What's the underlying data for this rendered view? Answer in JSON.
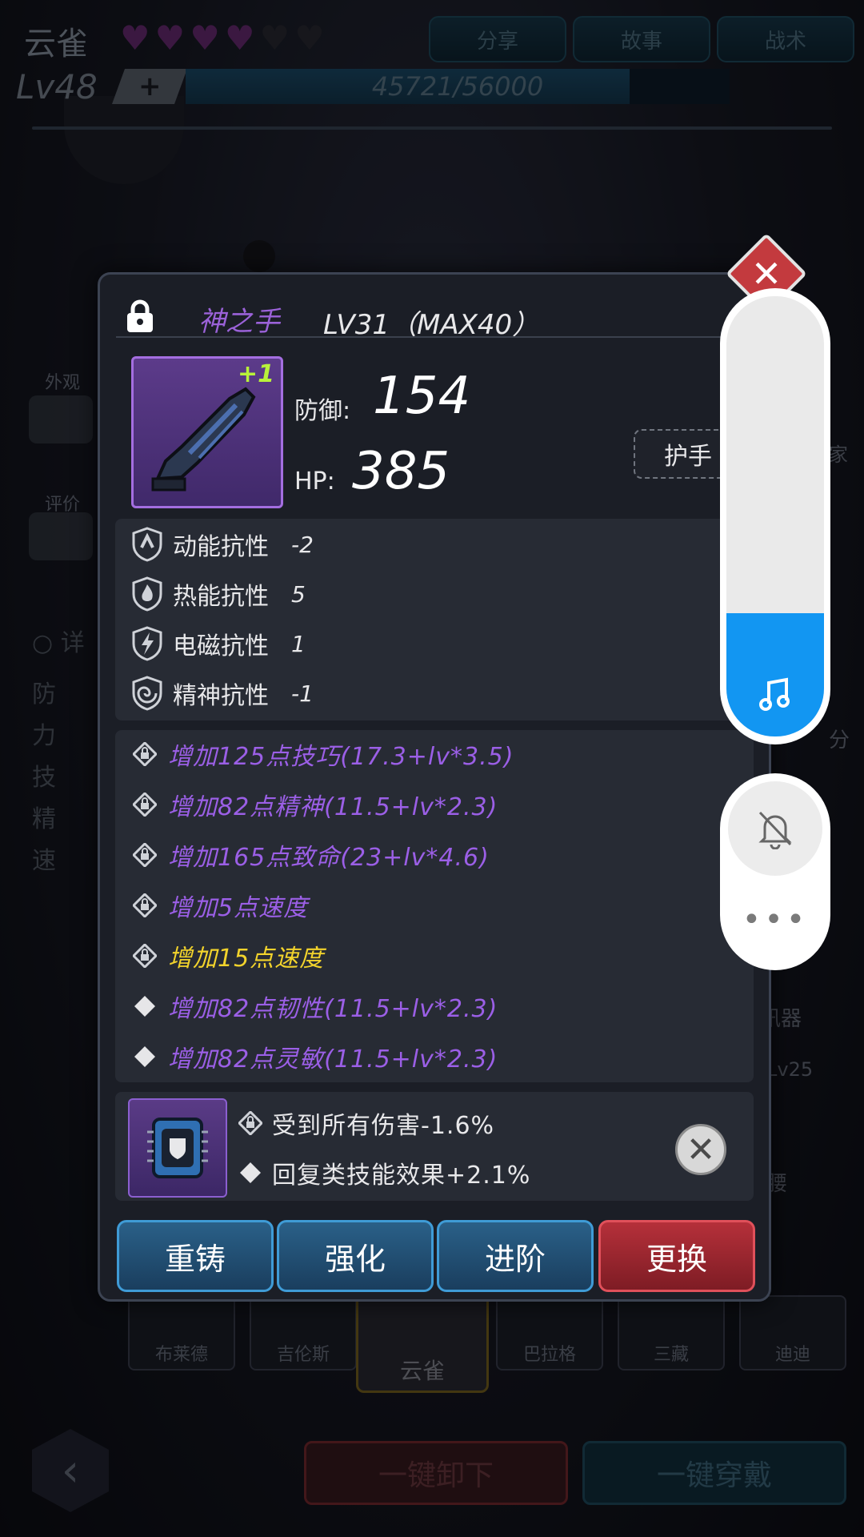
{
  "header": {
    "hero_name": "云雀",
    "hearts_filled": 4,
    "hearts_total": 6,
    "tabs": [
      "分享",
      "故事",
      "战术"
    ],
    "level": "Lv48",
    "plus": "+",
    "xp": "45721/56000",
    "xp_fraction": 0.816
  },
  "side": {
    "appearance_label": "外观",
    "rating_label": "评价",
    "detail_label": "详",
    "detail_rows": [
      "防",
      "力",
      "技",
      "精",
      "速"
    ]
  },
  "item": {
    "name": "神之手",
    "level_text": "LV31（MAX40）",
    "plus_badge": "+1",
    "defense_label": "防御:",
    "defense_value": "154",
    "hp_label": "HP:",
    "hp_value": "385",
    "slot": "护手"
  },
  "resistances": [
    {
      "name": "动能抗性",
      "value": "-2",
      "icon": "kinetic-resist-icon"
    },
    {
      "name": "热能抗性",
      "value": "5",
      "icon": "thermal-resist-icon"
    },
    {
      "name": "电磁抗性",
      "value": "1",
      "icon": "electromagnetic-resist-icon"
    },
    {
      "name": "精神抗性",
      "value": "-1",
      "icon": "mental-resist-icon"
    }
  ],
  "attributes": [
    {
      "text": "增加125点技巧(17.3+lv*3.5)",
      "color": "purple",
      "icon": "locked-attr-icon"
    },
    {
      "text": "增加82点精神(11.5+lv*2.3)",
      "color": "purple",
      "icon": "locked-attr-icon"
    },
    {
      "text": "增加165点致命(23+lv*4.6)",
      "color": "purple",
      "icon": "locked-attr-icon"
    },
    {
      "text": "增加5点速度",
      "color": "purple",
      "icon": "locked-attr-icon"
    },
    {
      "text": "增加15点速度",
      "color": "yellow",
      "icon": "locked-attr-icon"
    },
    {
      "text": "增加82点韧性(11.5+lv*2.3)",
      "color": "purple",
      "icon": "diamond-icon"
    },
    {
      "text": "增加82点灵敏(11.5+lv*2.3)",
      "color": "purple",
      "icon": "diamond-icon"
    }
  ],
  "gem": {
    "effects": [
      "受到所有伤害-1.6%",
      "回复类技能效果+2.1%"
    ]
  },
  "actions": [
    "重铸",
    "强化",
    "进阶",
    "更换"
  ],
  "bottom": {
    "heroes": [
      "布莱德",
      "吉伦斯",
      "云雀",
      "巴拉格",
      "三藏",
      "迪迪"
    ],
    "unequip_all": "一键卸下",
    "equip_all": "一键穿戴"
  },
  "right_peek": {
    "labels": [
      "家",
      "分",
      "讯器",
      "Lv25",
      "腰"
    ]
  },
  "volume": {
    "level": 0.28,
    "accent": "#1296f2"
  }
}
